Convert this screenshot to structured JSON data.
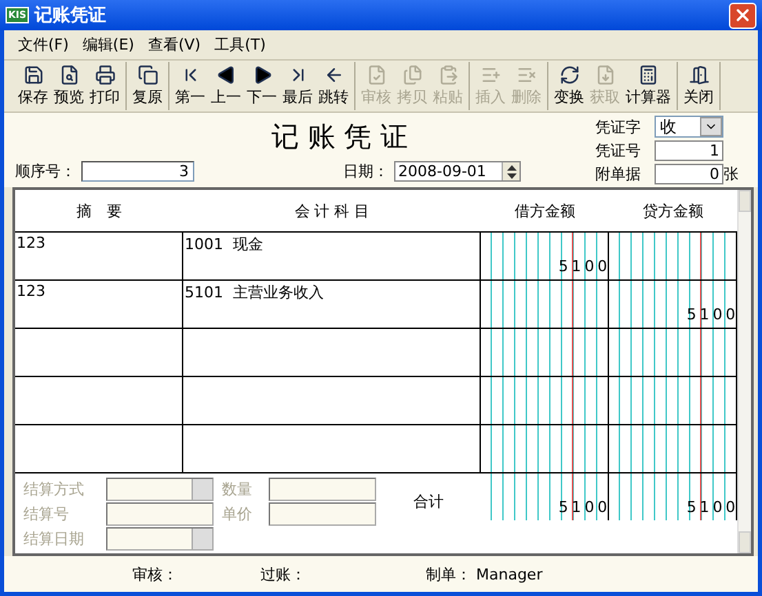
{
  "window": {
    "title": "记账凭证",
    "app_badge": "KIS"
  },
  "menu": [
    "文件(F)",
    "编辑(E)",
    "查看(V)",
    "工具(T)"
  ],
  "toolbar": [
    [
      {
        "label": "保存",
        "disabled": false
      },
      {
        "label": "预览",
        "disabled": false
      },
      {
        "label": "打印",
        "disabled": false
      }
    ],
    [
      {
        "label": "复原",
        "disabled": false
      }
    ],
    [
      {
        "label": "第一",
        "disabled": false
      },
      {
        "label": "上一",
        "disabled": false
      },
      {
        "label": "下一",
        "disabled": false
      },
      {
        "label": "最后",
        "disabled": false
      },
      {
        "label": "跳转",
        "disabled": false
      }
    ],
    [
      {
        "label": "审核",
        "disabled": true
      },
      {
        "label": "拷贝",
        "disabled": true
      },
      {
        "label": "粘贴",
        "disabled": true
      }
    ],
    [
      {
        "label": "插入",
        "disabled": true
      },
      {
        "label": "删除",
        "disabled": true
      }
    ],
    [
      {
        "label": "变换",
        "disabled": false
      },
      {
        "label": "获取",
        "disabled": true
      },
      {
        "label": "计算器",
        "disabled": false
      }
    ],
    [
      {
        "label": "关闭",
        "disabled": false
      }
    ]
  ],
  "form_title": "记 账 凭 证",
  "sequence": {
    "label": "顺序号：",
    "value": "3"
  },
  "date": {
    "label": "日期：",
    "value": "2008-09-01"
  },
  "voucher_type": {
    "label": "凭证字",
    "value": "收"
  },
  "voucher_no": {
    "label": "凭证号",
    "value": "1"
  },
  "attachments": {
    "label": "附单据",
    "value": "0",
    "unit": "张"
  },
  "table": {
    "columns": [
      "摘　要",
      "会 计 科 目",
      "借方金额",
      "贷方金额"
    ],
    "rows": [
      {
        "summary": "123",
        "account": "1001  现金",
        "debit": "5100"
      },
      {
        "summary": "123",
        "account": "5101  主营业务收入",
        "credit": "5100"
      }
    ],
    "total_label": "合计",
    "total_debit": "5100",
    "total_credit": "5100"
  },
  "settlement": [
    {
      "label": "结算方式",
      "kind": "combo",
      "disabled": true
    },
    {
      "label": "结算号",
      "kind": "text",
      "disabled": true
    },
    {
      "label": "结算日期",
      "kind": "date",
      "disabled": true
    }
  ],
  "quantity": [
    {
      "label": "数量",
      "disabled": true
    },
    {
      "label": "单价",
      "disabled": true
    }
  ],
  "footer": [
    {
      "label": "审核："
    },
    {
      "label": "过账："
    },
    {
      "label": "制单：",
      "value": "Manager"
    }
  ]
}
